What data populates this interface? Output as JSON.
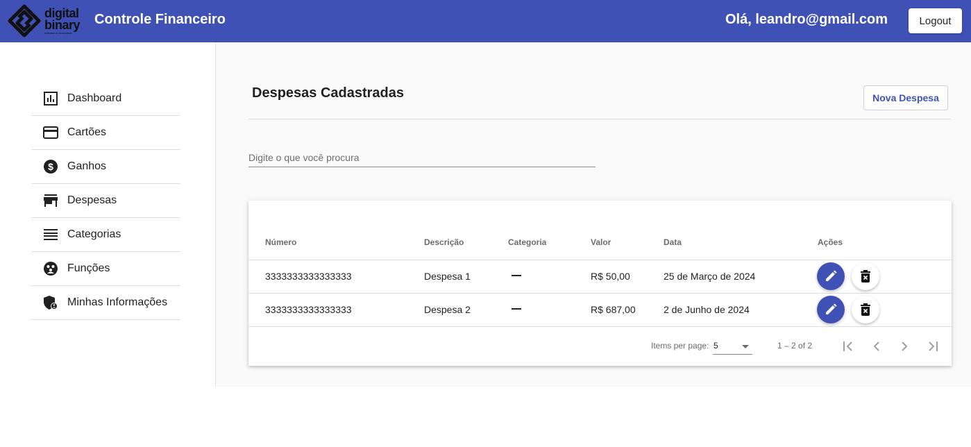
{
  "header": {
    "logo_line1": "digital",
    "logo_line2": "binary",
    "logo_tagline": "software & consultoria",
    "app_title": "Controle Financeiro",
    "greeting": "Olá, leandro@gmail.com",
    "logout_label": "Logout",
    "bg_color": "#3f51b5"
  },
  "sidebar": {
    "items": [
      {
        "label": "Dashboard",
        "icon": "bar-chart-icon"
      },
      {
        "label": "Cartões",
        "icon": "credit-card-icon"
      },
      {
        "label": "Ganhos",
        "icon": "dollar-circle-icon"
      },
      {
        "label": "Despesas",
        "icon": "store-icon"
      },
      {
        "label": "Categorias",
        "icon": "list-icon"
      },
      {
        "label": "Funções",
        "icon": "group-icon"
      },
      {
        "label": "Minhas Informações",
        "icon": "admin-shield-icon"
      }
    ]
  },
  "main": {
    "title": "Despesas Cadastradas",
    "new_button_label": "Nova Despesa",
    "search_placeholder": "Digite o que você procura",
    "table": {
      "columns": [
        "Número",
        "Descrição",
        "Categoria",
        "Valor",
        "Data",
        "Ações"
      ],
      "rows": [
        {
          "numero": "3333333333333333",
          "descricao": "Despesa 1",
          "categoria": "—",
          "valor": "R$ 50,00",
          "data": "25 de Março de 2024"
        },
        {
          "numero": "3333333333333333",
          "descricao": "Despesa 2",
          "categoria": "—",
          "valor": "R$ 687,00",
          "data": "2 de Junho de 2024"
        }
      ]
    },
    "paginator": {
      "items_per_page_label": "Items per page:",
      "items_per_page_value": "5",
      "range_label": "1 – 2 of 2"
    }
  }
}
